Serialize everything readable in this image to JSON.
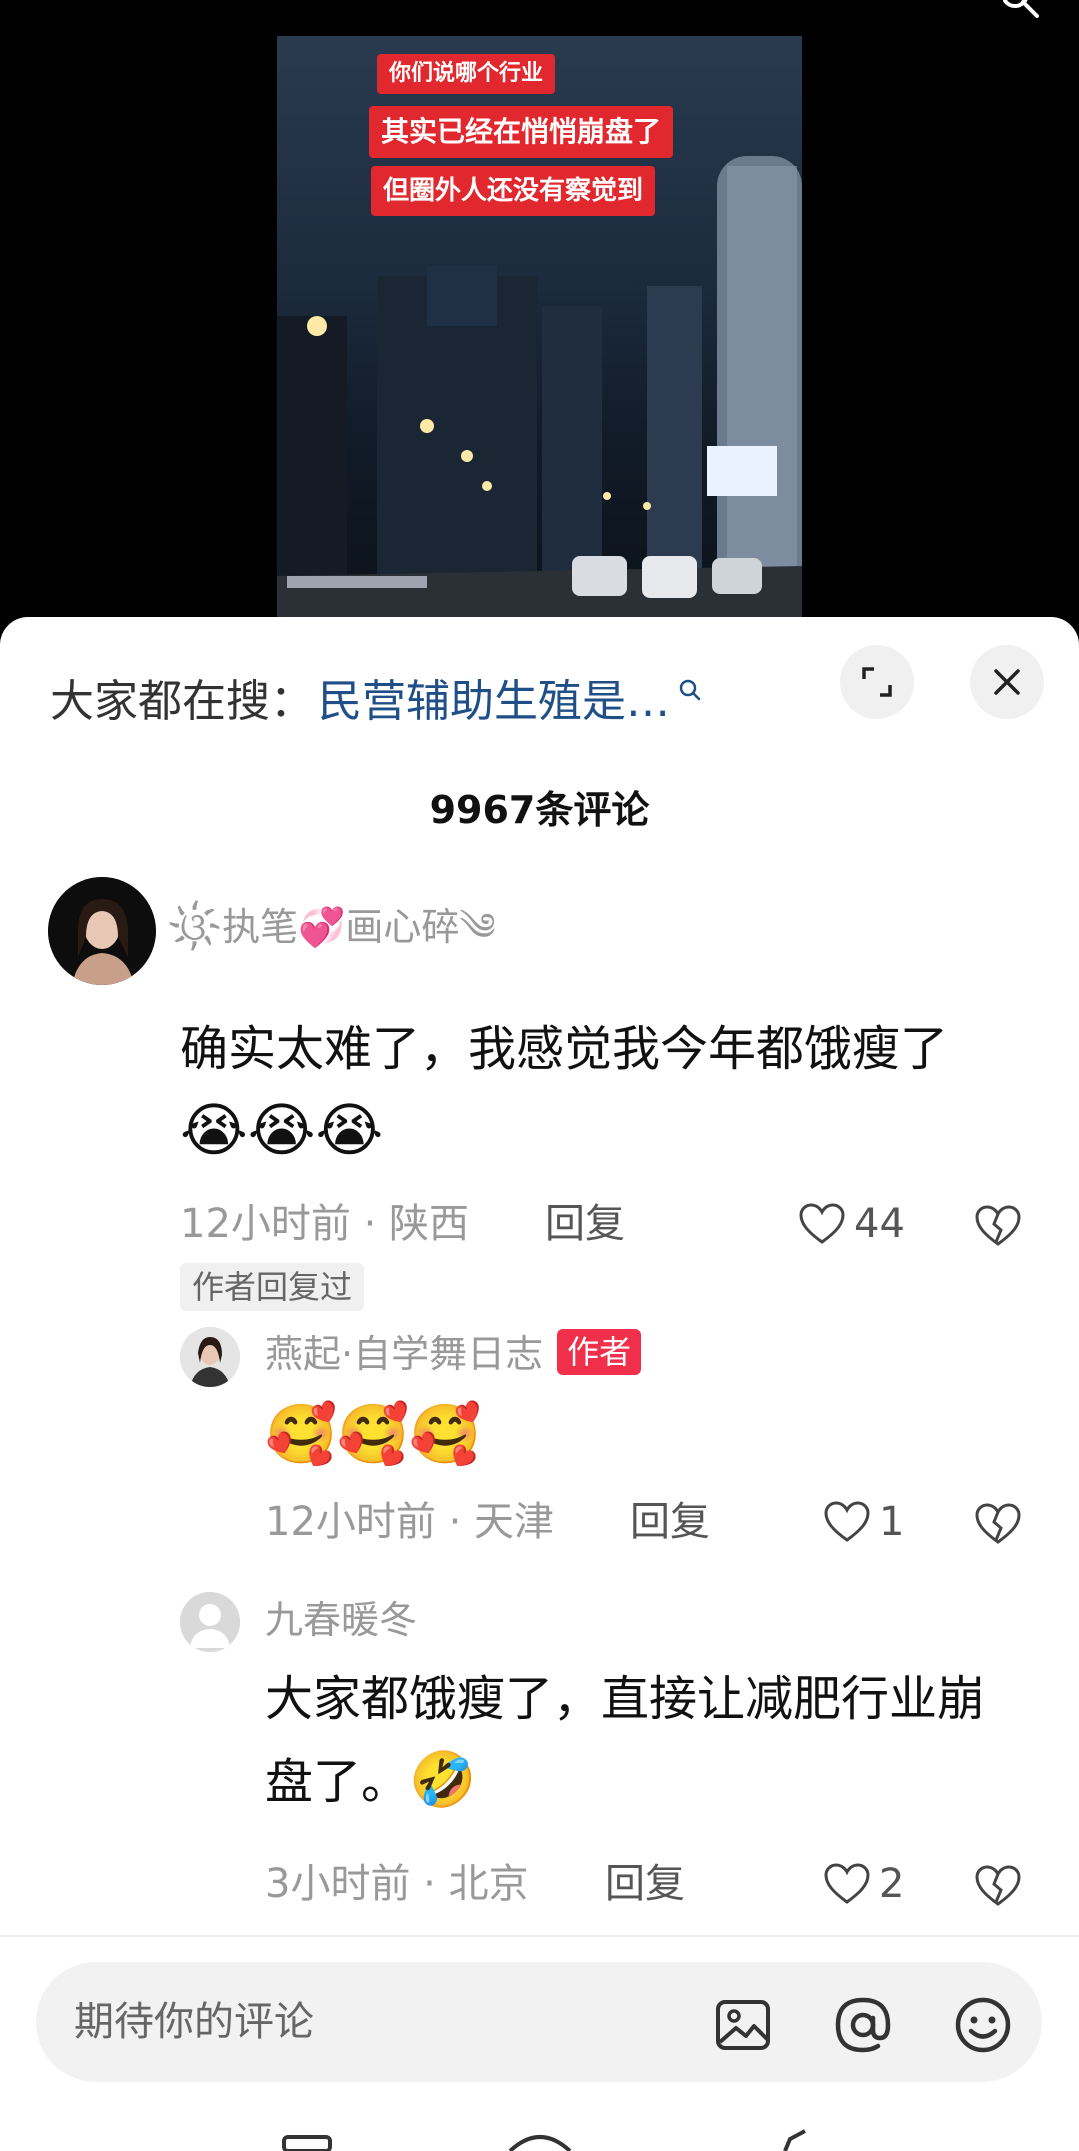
{
  "video": {
    "captions": [
      "你们说哪个行业",
      "其实已经在悄悄崩盘了",
      "但圈外人还没有察觉到"
    ]
  },
  "sheet": {
    "trending_prefix": "大家都在搜：",
    "trending_query": "民营辅助生殖是…",
    "comment_count": "9967条评论"
  },
  "comments": [
    {
      "username": "ଓ҉执笔💞画心碎༄",
      "text": "确实太难了，我感觉我今年都饿瘦了",
      "emoji": "😭😭😭",
      "time": "12小时前 · 陕西",
      "reply": "回复",
      "likes": "44",
      "tag": "作者回复过"
    },
    {
      "username": "燕起·自学舞日志",
      "badge": "作者",
      "emoji": "🥰🥰🥰",
      "time": "12小时前 · 天津",
      "reply": "回复",
      "likes": "1"
    },
    {
      "username": "九春暖冬",
      "text_line1": "大家都饿瘦了，直接让减肥行业崩",
      "text_line2": "盘了。",
      "emoji": "🤣",
      "time": "3小时前 · 北京",
      "reply": "回复",
      "likes": "2"
    }
  ],
  "input": {
    "placeholder": "期待你的评论"
  },
  "colors": {
    "sheet_bg": "#ffffff",
    "link": "#1f4f86",
    "author_badge": "#f0304a",
    "caption_bg": "#e0282e"
  },
  "icons": [
    "search-icon",
    "expand-icon",
    "close-icon",
    "heart-icon",
    "broken-heart-icon",
    "image-icon",
    "at-icon",
    "smiley-icon"
  ]
}
